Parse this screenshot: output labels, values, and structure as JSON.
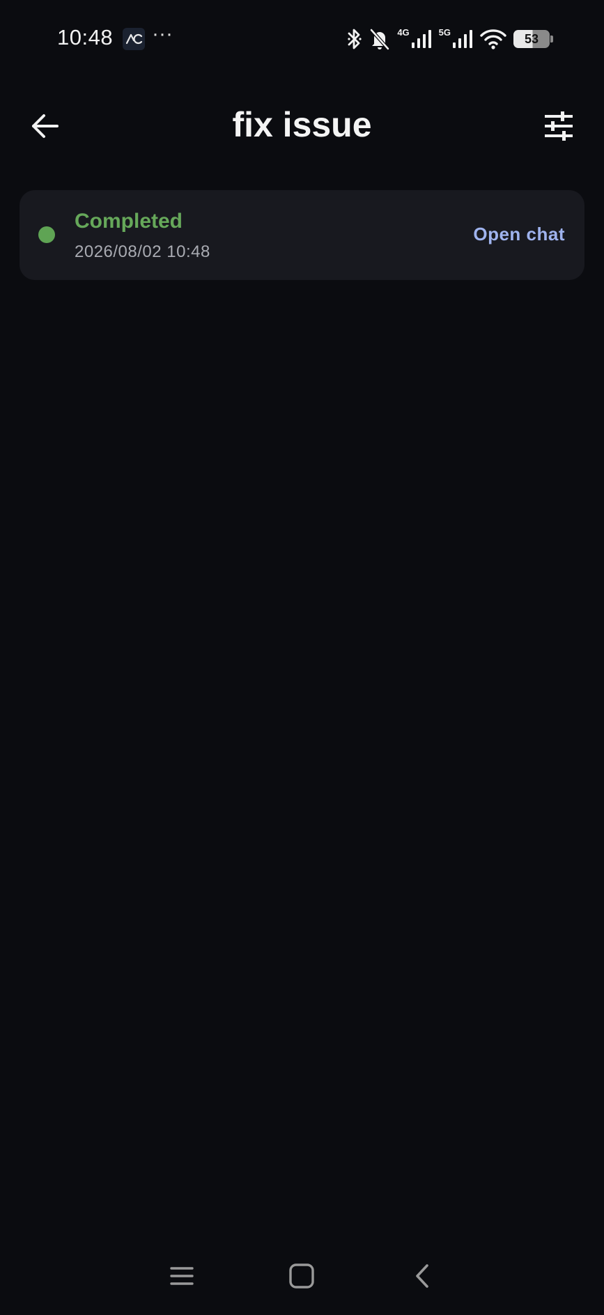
{
  "status_bar": {
    "time": "10:48",
    "app_icon": "activity-icon",
    "overflow": "···",
    "network_4g": "4G",
    "network_5g": "5G",
    "battery_level": "53"
  },
  "header": {
    "title": "fix issue",
    "back_icon": "arrow-left-icon",
    "filter_icon": "sliders-icon"
  },
  "task": {
    "status": "Completed",
    "timestamp": "2026/08/02 10:48",
    "action_label": "Open chat",
    "status_color": "#5fa454",
    "action_color": "#9fb3ee"
  },
  "nav": {
    "icons": [
      "menu-icon",
      "home-icon",
      "back-icon"
    ]
  },
  "theme": {
    "background": "#0b0c10",
    "card": "#18191f"
  }
}
